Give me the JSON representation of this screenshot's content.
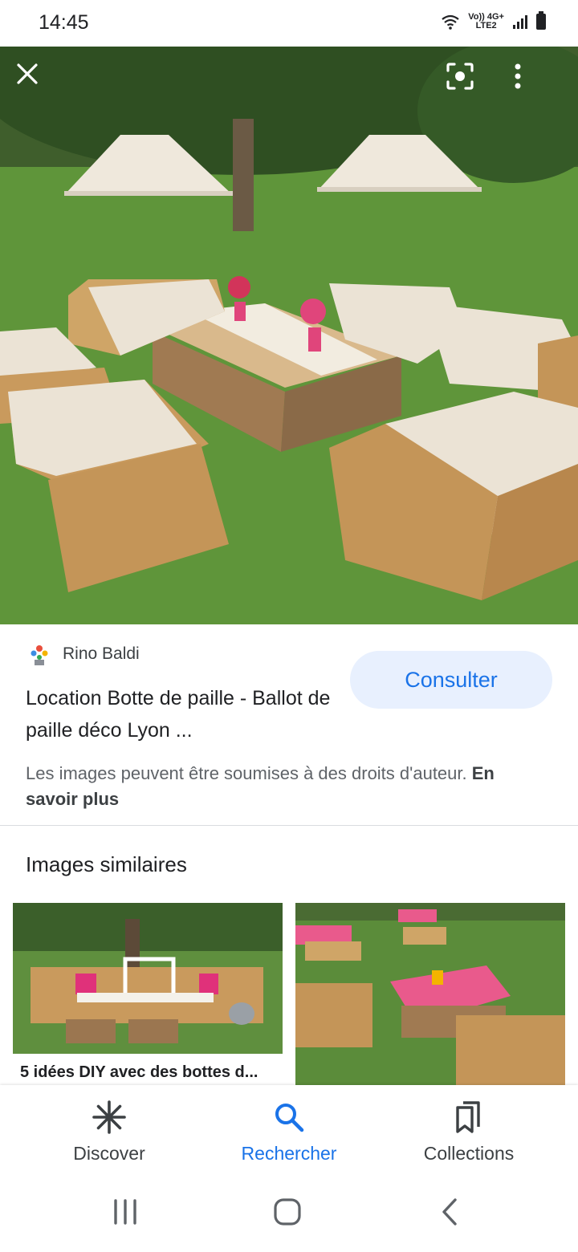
{
  "status": {
    "time": "14:45",
    "network_top": "Vo)) 4G+",
    "network_bottom": "LTE2"
  },
  "source": {
    "name": "Rino Baldi"
  },
  "result": {
    "title": "Location Botte de paille - Ballot de paille déco Lyon ...",
    "consult_label": "Consulter"
  },
  "copyright": {
    "text": "Les images peuvent être soumises à des droits d'auteur.",
    "link": "En savoir plus"
  },
  "similar": {
    "title": "Images similaires",
    "items": [
      {
        "caption": "5 idées DIY avec des bottes d..."
      },
      {
        "caption": ""
      }
    ]
  },
  "bottom_nav": {
    "items": [
      {
        "label": "Discover",
        "icon": "asterisk-icon"
      },
      {
        "label": "Rechercher",
        "icon": "search-icon",
        "active": true
      },
      {
        "label": "Collections",
        "icon": "bookmarks-icon"
      }
    ]
  },
  "colors": {
    "accent": "#1a73e8",
    "consult_bg": "#e8f0fe"
  }
}
